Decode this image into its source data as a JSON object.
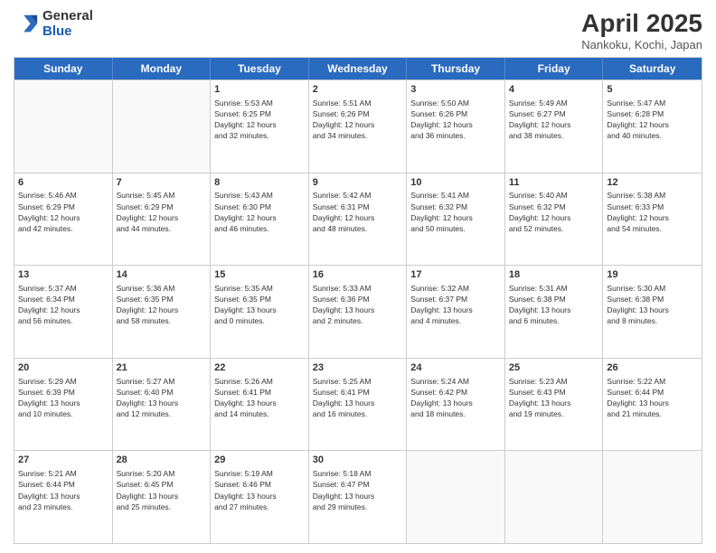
{
  "logo": {
    "general": "General",
    "blue": "Blue"
  },
  "title": "April 2025",
  "subtitle": "Nankoku, Kochi, Japan",
  "headers": [
    "Sunday",
    "Monday",
    "Tuesday",
    "Wednesday",
    "Thursday",
    "Friday",
    "Saturday"
  ],
  "rows": [
    [
      {
        "day": "",
        "text": ""
      },
      {
        "day": "",
        "text": ""
      },
      {
        "day": "1",
        "text": "Sunrise: 5:53 AM\nSunset: 6:25 PM\nDaylight: 12 hours\nand 32 minutes."
      },
      {
        "day": "2",
        "text": "Sunrise: 5:51 AM\nSunset: 6:26 PM\nDaylight: 12 hours\nand 34 minutes."
      },
      {
        "day": "3",
        "text": "Sunrise: 5:50 AM\nSunset: 6:26 PM\nDaylight: 12 hours\nand 36 minutes."
      },
      {
        "day": "4",
        "text": "Sunrise: 5:49 AM\nSunset: 6:27 PM\nDaylight: 12 hours\nand 38 minutes."
      },
      {
        "day": "5",
        "text": "Sunrise: 5:47 AM\nSunset: 6:28 PM\nDaylight: 12 hours\nand 40 minutes."
      }
    ],
    [
      {
        "day": "6",
        "text": "Sunrise: 5:46 AM\nSunset: 6:29 PM\nDaylight: 12 hours\nand 42 minutes."
      },
      {
        "day": "7",
        "text": "Sunrise: 5:45 AM\nSunset: 6:29 PM\nDaylight: 12 hours\nand 44 minutes."
      },
      {
        "day": "8",
        "text": "Sunrise: 5:43 AM\nSunset: 6:30 PM\nDaylight: 12 hours\nand 46 minutes."
      },
      {
        "day": "9",
        "text": "Sunrise: 5:42 AM\nSunset: 6:31 PM\nDaylight: 12 hours\nand 48 minutes."
      },
      {
        "day": "10",
        "text": "Sunrise: 5:41 AM\nSunset: 6:32 PM\nDaylight: 12 hours\nand 50 minutes."
      },
      {
        "day": "11",
        "text": "Sunrise: 5:40 AM\nSunset: 6:32 PM\nDaylight: 12 hours\nand 52 minutes."
      },
      {
        "day": "12",
        "text": "Sunrise: 5:38 AM\nSunset: 6:33 PM\nDaylight: 12 hours\nand 54 minutes."
      }
    ],
    [
      {
        "day": "13",
        "text": "Sunrise: 5:37 AM\nSunset: 6:34 PM\nDaylight: 12 hours\nand 56 minutes."
      },
      {
        "day": "14",
        "text": "Sunrise: 5:36 AM\nSunset: 6:35 PM\nDaylight: 12 hours\nand 58 minutes."
      },
      {
        "day": "15",
        "text": "Sunrise: 5:35 AM\nSunset: 6:35 PM\nDaylight: 13 hours\nand 0 minutes."
      },
      {
        "day": "16",
        "text": "Sunrise: 5:33 AM\nSunset: 6:36 PM\nDaylight: 13 hours\nand 2 minutes."
      },
      {
        "day": "17",
        "text": "Sunrise: 5:32 AM\nSunset: 6:37 PM\nDaylight: 13 hours\nand 4 minutes."
      },
      {
        "day": "18",
        "text": "Sunrise: 5:31 AM\nSunset: 6:38 PM\nDaylight: 13 hours\nand 6 minutes."
      },
      {
        "day": "19",
        "text": "Sunrise: 5:30 AM\nSunset: 6:38 PM\nDaylight: 13 hours\nand 8 minutes."
      }
    ],
    [
      {
        "day": "20",
        "text": "Sunrise: 5:29 AM\nSunset: 6:39 PM\nDaylight: 13 hours\nand 10 minutes."
      },
      {
        "day": "21",
        "text": "Sunrise: 5:27 AM\nSunset: 6:40 PM\nDaylight: 13 hours\nand 12 minutes."
      },
      {
        "day": "22",
        "text": "Sunrise: 5:26 AM\nSunset: 6:41 PM\nDaylight: 13 hours\nand 14 minutes."
      },
      {
        "day": "23",
        "text": "Sunrise: 5:25 AM\nSunset: 6:41 PM\nDaylight: 13 hours\nand 16 minutes."
      },
      {
        "day": "24",
        "text": "Sunrise: 5:24 AM\nSunset: 6:42 PM\nDaylight: 13 hours\nand 18 minutes."
      },
      {
        "day": "25",
        "text": "Sunrise: 5:23 AM\nSunset: 6:43 PM\nDaylight: 13 hours\nand 19 minutes."
      },
      {
        "day": "26",
        "text": "Sunrise: 5:22 AM\nSunset: 6:44 PM\nDaylight: 13 hours\nand 21 minutes."
      }
    ],
    [
      {
        "day": "27",
        "text": "Sunrise: 5:21 AM\nSunset: 6:44 PM\nDaylight: 13 hours\nand 23 minutes."
      },
      {
        "day": "28",
        "text": "Sunrise: 5:20 AM\nSunset: 6:45 PM\nDaylight: 13 hours\nand 25 minutes."
      },
      {
        "day": "29",
        "text": "Sunrise: 5:19 AM\nSunset: 6:46 PM\nDaylight: 13 hours\nand 27 minutes."
      },
      {
        "day": "30",
        "text": "Sunrise: 5:18 AM\nSunset: 6:47 PM\nDaylight: 13 hours\nand 29 minutes."
      },
      {
        "day": "",
        "text": ""
      },
      {
        "day": "",
        "text": ""
      },
      {
        "day": "",
        "text": ""
      }
    ]
  ]
}
